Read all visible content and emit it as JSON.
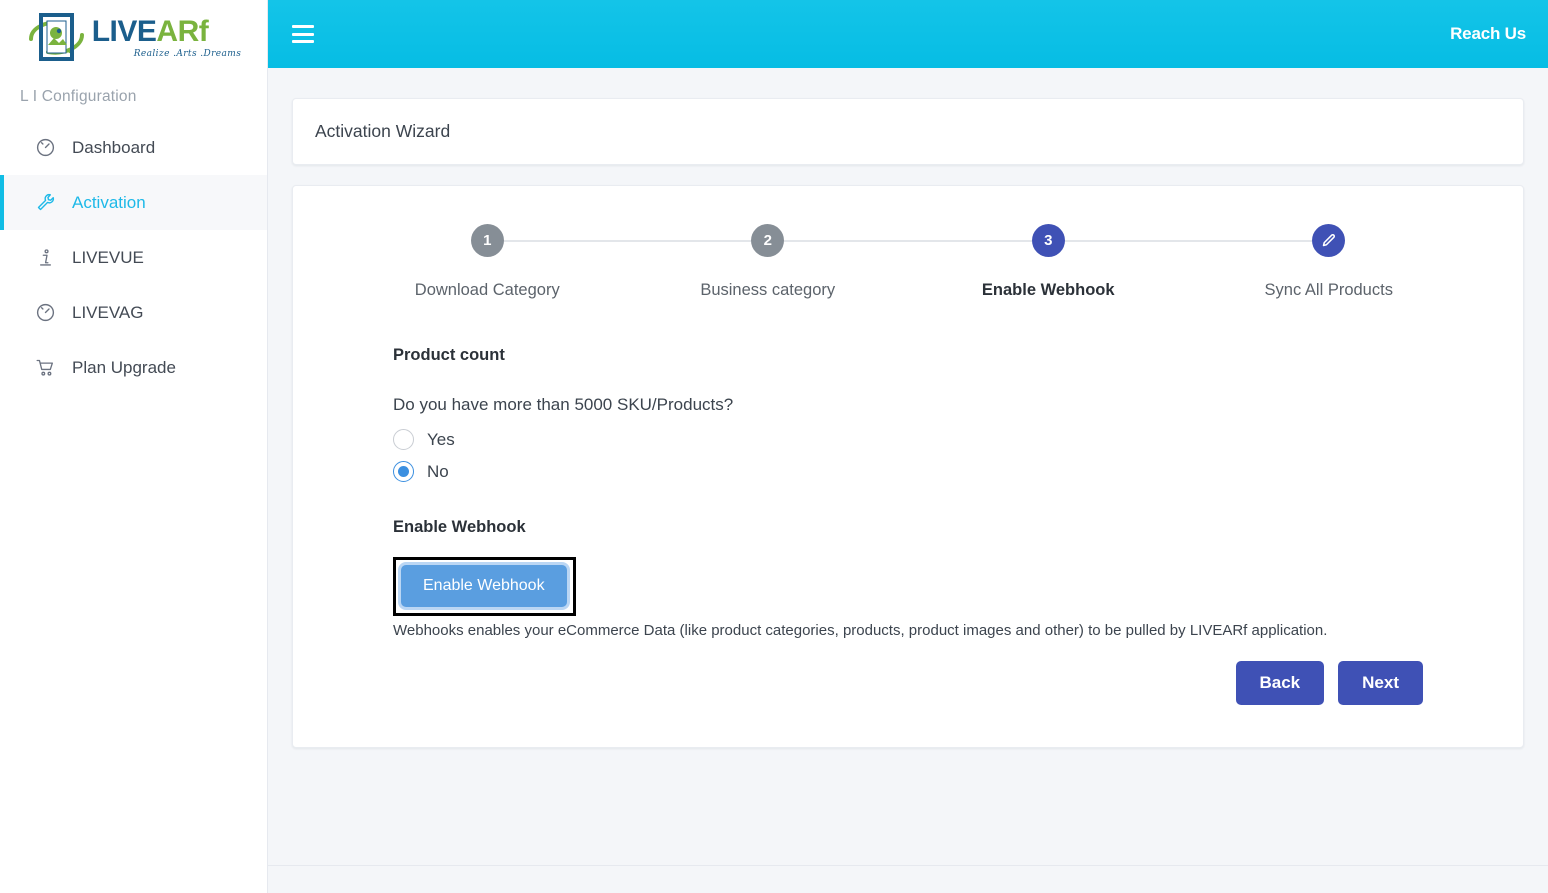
{
  "brand": {
    "logo_word_1": "LIVE",
    "logo_word_2": "ARf",
    "tagline": "Realize .Arts .Dreams",
    "logo_icon": "framed-picture-rotate-icon"
  },
  "sidebar": {
    "section_title": "L I Configuration",
    "items": [
      {
        "label": "Dashboard",
        "icon": "speedometer-icon",
        "active": false
      },
      {
        "label": "Activation",
        "icon": "wrench-icon",
        "active": true
      },
      {
        "label": "LIVEVUE",
        "icon": "info-icon",
        "active": false
      },
      {
        "label": "LIVEVAG",
        "icon": "speedometer-icon",
        "active": false
      },
      {
        "label": "Plan Upgrade",
        "icon": "shopping-cart-icon",
        "active": false
      }
    ]
  },
  "topbar": {
    "menu_icon": "hamburger-icon",
    "reach_us": "Reach Us",
    "background": "#08bfe5"
  },
  "page": {
    "card_title": "Activation Wizard"
  },
  "wizard": {
    "steps": [
      {
        "number": "1",
        "label": "Download Category",
        "state": "done"
      },
      {
        "number": "2",
        "label": "Business category",
        "state": "done"
      },
      {
        "number": "3",
        "label": "Enable Webhook",
        "state": "active"
      },
      {
        "number": "✎",
        "label": "Sync All Products",
        "state": "edit"
      }
    ],
    "active_color": "#3f51b5",
    "done_color": "#868e96"
  },
  "form": {
    "product_count_heading": "Product count",
    "question": "Do you have more than 5000 SKU/Products?",
    "options": [
      {
        "label": "Yes",
        "checked": false
      },
      {
        "label": "No",
        "checked": true
      }
    ],
    "enable_webhook_heading": "Enable Webhook",
    "enable_webhook_button": "Enable Webhook",
    "webhook_description": "Webhooks enables your eCommerce Data (like product categories, products, product images and other) to be pulled by LIVEARf application.",
    "button_color": "#5a9ee0"
  },
  "actions": {
    "back": "Back",
    "next": "Next",
    "button_color": "#3f51b5"
  }
}
